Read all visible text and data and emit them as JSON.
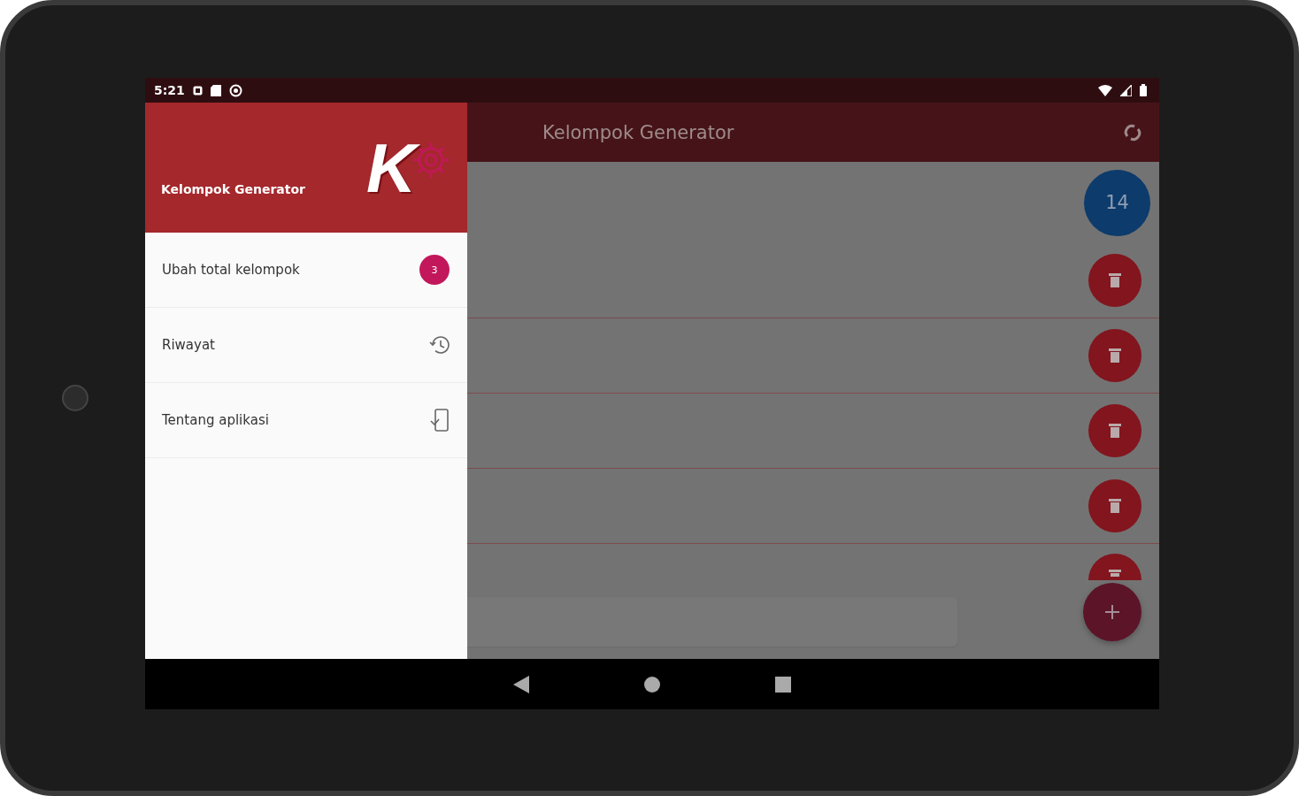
{
  "status_bar": {
    "time": "5:21"
  },
  "drawer": {
    "header": {
      "title": "Kelompok Generator",
      "logo_letter": "K"
    },
    "items": [
      {
        "label": "Ubah total kelompok",
        "kind": "badge",
        "badge": "3"
      },
      {
        "label": "Riwayat",
        "kind": "history"
      },
      {
        "label": "Tentang aplikasi",
        "kind": "about"
      }
    ]
  },
  "app_bar": {
    "title": "Kelompok Generator"
  },
  "member_count": "14",
  "rows": [
    {
      "kind": "member"
    },
    {
      "kind": "member"
    },
    {
      "kind": "member"
    },
    {
      "kind": "member"
    },
    {
      "kind": "partial"
    }
  ]
}
